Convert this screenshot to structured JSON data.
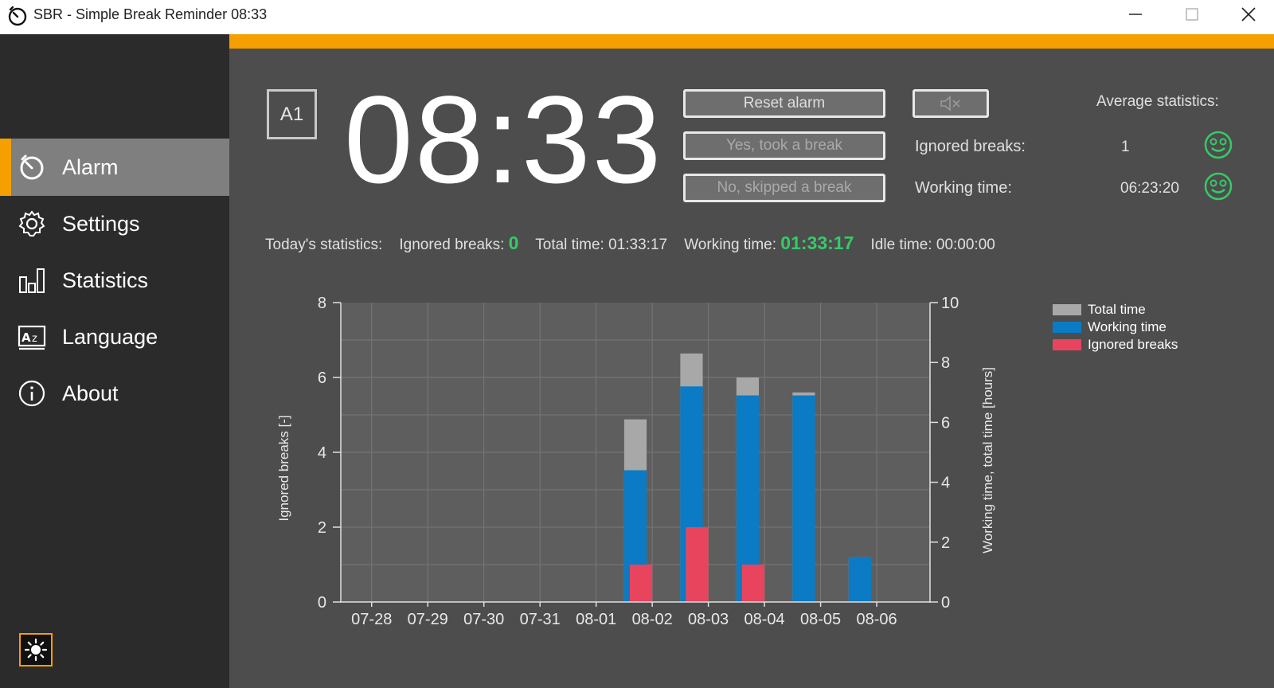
{
  "window": {
    "title": "SBR - Simple Break Reminder  08:33"
  },
  "colors": {
    "accent": "#f5a000",
    "total": "#a8a8a8",
    "working": "#0a7bc4",
    "ignored": "#e8445e",
    "good": "#33cc66"
  },
  "sidebar": {
    "items": [
      {
        "label": "Alarm",
        "icon": "alarm-icon",
        "active": true
      },
      {
        "label": "Settings",
        "icon": "gear-icon",
        "active": false
      },
      {
        "label": "Statistics",
        "icon": "bar-chart-icon",
        "active": false
      },
      {
        "label": "Language",
        "icon": "language-icon",
        "active": false
      },
      {
        "label": "About",
        "icon": "info-icon",
        "active": false
      }
    ]
  },
  "alarm": {
    "badge": "A1",
    "clock": "08:33",
    "reset_label": "Reset alarm",
    "yes_label": "Yes, took a break",
    "no_label": "No, skipped a break"
  },
  "average": {
    "title": "Average statistics:",
    "ignored_label": "Ignored breaks:",
    "ignored_value": "1",
    "working_label": "Working time:",
    "working_value": "06:23:20"
  },
  "today": {
    "label": "Today's statistics:",
    "ignored_label": "Ignored breaks:",
    "ignored_value": "0",
    "total_label": "Total time:",
    "total_value": "01:33:17",
    "working_label": "Working time:",
    "working_value": "01:33:17",
    "idle_label": "Idle time:",
    "idle_value": "00:00:00"
  },
  "chart_data": {
    "type": "bar",
    "categories": [
      "07-28",
      "07-29",
      "07-30",
      "07-31",
      "08-01",
      "08-02",
      "08-03",
      "08-04",
      "08-05",
      "08-06"
    ],
    "series": [
      {
        "name": "Total time",
        "axis": "right",
        "values": [
          0,
          0,
          0,
          0,
          0,
          6.1,
          8.3,
          7.5,
          7.0,
          1.5
        ]
      },
      {
        "name": "Working time",
        "axis": "right",
        "values": [
          0,
          0,
          0,
          0,
          0,
          4.4,
          7.2,
          6.9,
          6.9,
          1.5
        ]
      },
      {
        "name": "Ignored breaks",
        "axis": "left",
        "values": [
          0,
          0,
          0,
          0,
          0,
          1,
          2,
          1,
          0,
          0
        ]
      }
    ],
    "ylabel_left": "Ignored breaks [-]",
    "ylabel_right": "Working time, total time [hours]",
    "ylim_left": [
      0,
      8
    ],
    "ylim_right": [
      0,
      10
    ],
    "yticks_left": [
      "0",
      "2",
      "4",
      "6",
      "8"
    ],
    "yticks_right": [
      "0",
      "2",
      "4",
      "6",
      "8",
      "10"
    ],
    "grid": true,
    "legend": "top-right"
  }
}
